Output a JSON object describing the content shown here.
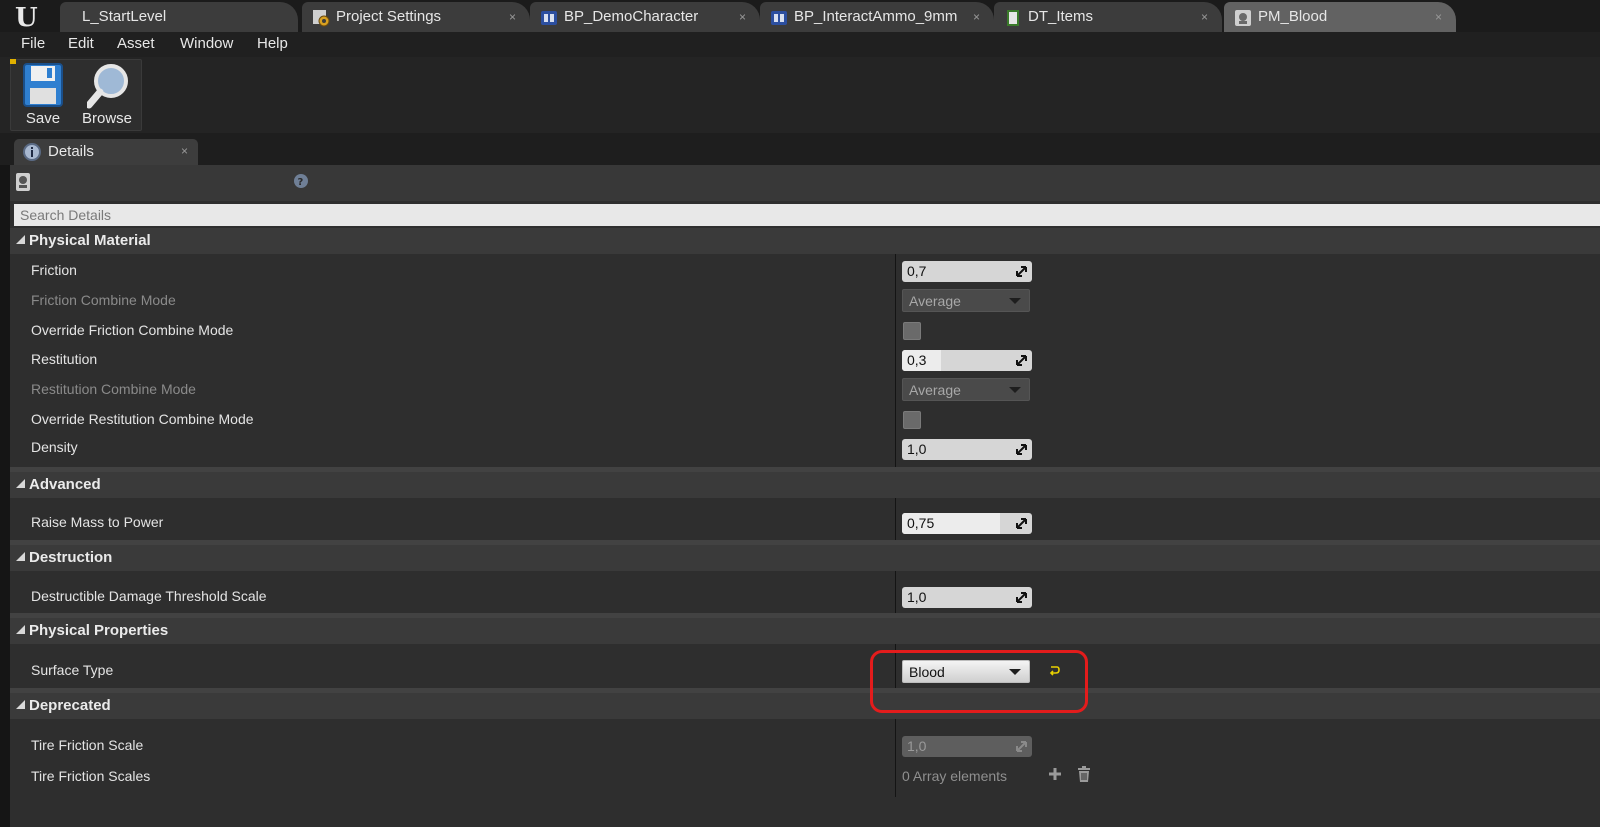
{
  "tabs": [
    {
      "label": "L_StartLevel",
      "icon": "level-icon"
    },
    {
      "label": "Project Settings",
      "icon": "settings-gear-icon"
    },
    {
      "label": "BP_DemoCharacter",
      "icon": "blueprint-icon"
    },
    {
      "label": "BP_InteractAmmo_9mm",
      "icon": "blueprint-icon"
    },
    {
      "label": "DT_Items",
      "icon": "data-table-icon"
    },
    {
      "label": "PM_Blood",
      "icon": "physical-material-icon"
    }
  ],
  "tab_close": "×",
  "menu": [
    "File",
    "Edit",
    "Asset",
    "Window",
    "Help"
  ],
  "toolbar": {
    "save_label": "Save",
    "browse_label": "Browse"
  },
  "panel": {
    "tab_label": "Details",
    "tab_close": "×",
    "search_placeholder": "Search Details"
  },
  "sections": {
    "physical_material": {
      "title": "Physical Material",
      "friction": {
        "label": "Friction",
        "value": "0,7",
        "slider_fraction": 0
      },
      "friction_combine_mode": {
        "label": "Friction Combine Mode",
        "value": "Average"
      },
      "override_friction_combine_mode": {
        "label": "Override Friction Combine Mode",
        "checked": false
      },
      "restitution": {
        "label": "Restitution",
        "value": "0,3",
        "slider_fraction": 0.3
      },
      "restitution_combine_mode": {
        "label": "Restitution Combine Mode",
        "value": "Average"
      },
      "override_restitution_combine_mode": {
        "label": "Override Restitution Combine Mode",
        "checked": false
      },
      "density": {
        "label": "Density",
        "value": "1,0",
        "slider_fraction": 0
      }
    },
    "advanced": {
      "title": "Advanced",
      "raise_mass_to_power": {
        "label": "Raise Mass to Power",
        "value": "0,75",
        "slider_fraction": 0.75
      }
    },
    "destruction": {
      "title": "Destruction",
      "damage_threshold": {
        "label": "Destructible Damage Threshold Scale",
        "value": "1,0",
        "slider_fraction": 0
      }
    },
    "physical_properties": {
      "title": "Physical Properties",
      "surface_type": {
        "label": "Surface Type",
        "value": "Blood"
      }
    },
    "deprecated": {
      "title": "Deprecated",
      "tire_friction_scale": {
        "label": "Tire Friction Scale",
        "value": "1,0"
      },
      "tire_friction_scales": {
        "label": "Tire Friction Scales",
        "value": "0 Array elements"
      }
    }
  },
  "colors": {
    "highlight": "#e31c1c",
    "accent": "#e0b000",
    "reset_arrow": "#e8d000"
  }
}
